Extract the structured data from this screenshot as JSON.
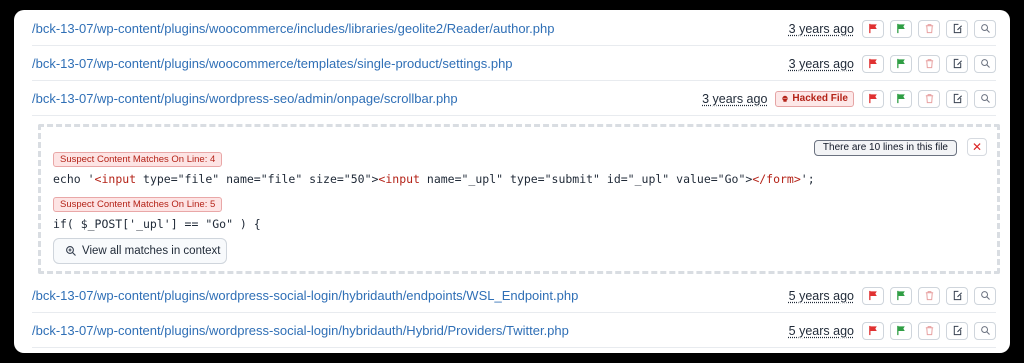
{
  "rows_top": [
    {
      "path": "/bck-13-07/wp-content/plugins/woocommerce/includes/libraries/geolite2/Reader/author.php",
      "time": "3 years ago",
      "hacked": false
    },
    {
      "path": "/bck-13-07/wp-content/plugins/woocommerce/templates/single-product/settings.php",
      "time": "3 years ago",
      "hacked": false
    },
    {
      "path": "/bck-13-07/wp-content/plugins/wordpress-seo/admin/onpage/scrollbar.php",
      "time": "3 years ago",
      "hacked": true,
      "hacked_label": "Hacked File"
    }
  ],
  "detail": {
    "lines_info": "There are 10 lines in this file",
    "close_symbol": "✕",
    "matches": [
      {
        "label": "Suspect Content Matches On Line: 4",
        "code_parts": [
          "echo '",
          "<input",
          " type=\"file\" name=\"file\" size=\"50\">",
          "<input",
          " name=\"_upl\" type=\"submit\" id=\"_upl\" value=\"Go\">",
          "</form>",
          "';"
        ]
      },
      {
        "label": "Suspect Content Matches On Line: 5",
        "code_parts": [
          "if( $_POST['_upl'] == \"Go\" ) {"
        ]
      }
    ],
    "context_button": "View all matches in context"
  },
  "rows_bottom": [
    {
      "path": "/bck-13-07/wp-content/plugins/wordpress-social-login/hybridauth/endpoints/WSL_Endpoint.php",
      "time": "5 years ago",
      "hacked": false
    },
    {
      "path": "/bck-13-07/wp-content/plugins/wordpress-social-login/hybridauth/Hybrid/Providers/Twitter.php",
      "time": "5 years ago",
      "hacked": false
    }
  ],
  "colors": {
    "link": "#2f6fb6",
    "flag_red": "#e03131",
    "flag_green": "#2f9e44",
    "danger": "#b42318"
  },
  "icons": [
    "red-flag-icon",
    "green-flag-icon",
    "trash-icon",
    "edit-file-icon",
    "search-icon",
    "skull-icon",
    "zoom-icon"
  ]
}
